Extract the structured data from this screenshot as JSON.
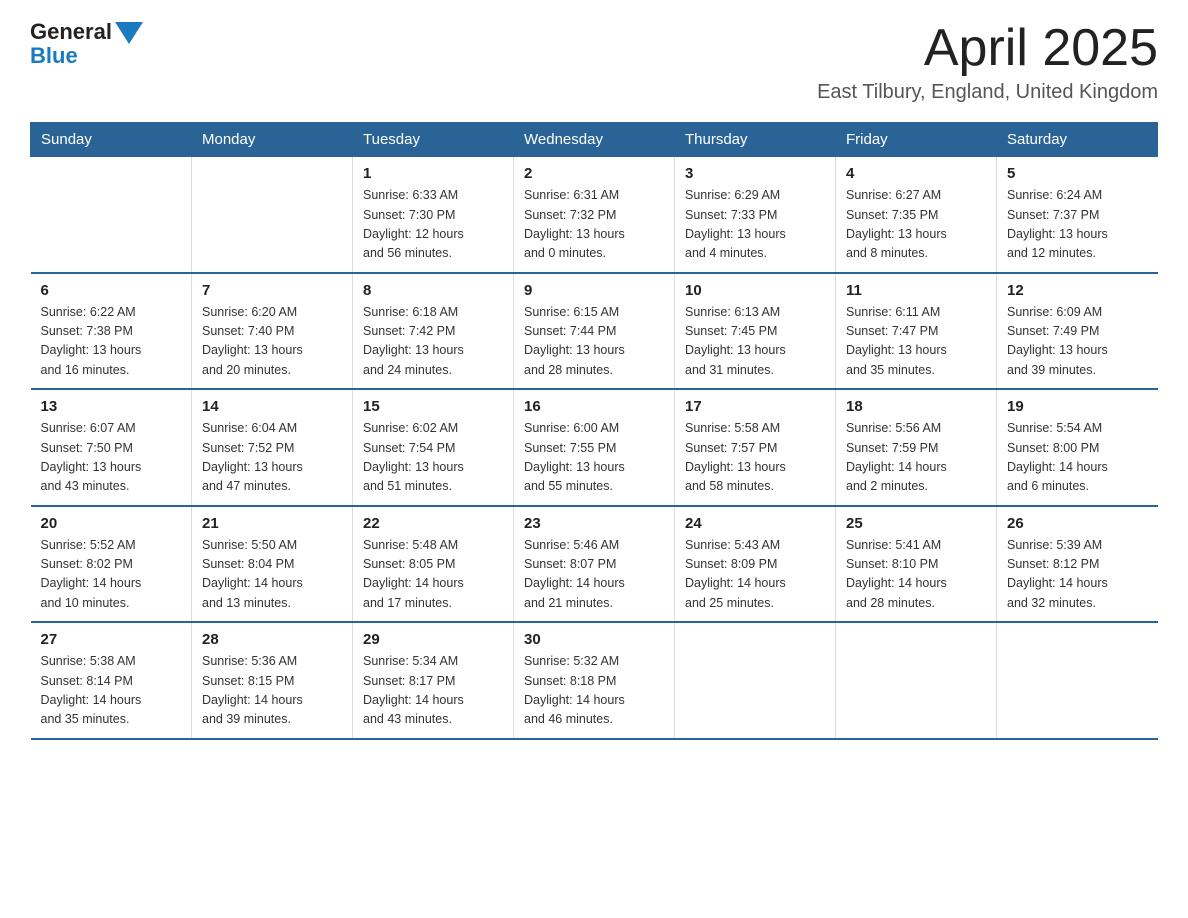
{
  "header": {
    "logo_line1": "General",
    "logo_line2": "Blue",
    "month_title": "April 2025",
    "location": "East Tilbury, England, United Kingdom"
  },
  "days_of_week": [
    "Sunday",
    "Monday",
    "Tuesday",
    "Wednesday",
    "Thursday",
    "Friday",
    "Saturday"
  ],
  "weeks": [
    [
      {
        "day": "",
        "info": ""
      },
      {
        "day": "",
        "info": ""
      },
      {
        "day": "1",
        "info": "Sunrise: 6:33 AM\nSunset: 7:30 PM\nDaylight: 12 hours\nand 56 minutes."
      },
      {
        "day": "2",
        "info": "Sunrise: 6:31 AM\nSunset: 7:32 PM\nDaylight: 13 hours\nand 0 minutes."
      },
      {
        "day": "3",
        "info": "Sunrise: 6:29 AM\nSunset: 7:33 PM\nDaylight: 13 hours\nand 4 minutes."
      },
      {
        "day": "4",
        "info": "Sunrise: 6:27 AM\nSunset: 7:35 PM\nDaylight: 13 hours\nand 8 minutes."
      },
      {
        "day": "5",
        "info": "Sunrise: 6:24 AM\nSunset: 7:37 PM\nDaylight: 13 hours\nand 12 minutes."
      }
    ],
    [
      {
        "day": "6",
        "info": "Sunrise: 6:22 AM\nSunset: 7:38 PM\nDaylight: 13 hours\nand 16 minutes."
      },
      {
        "day": "7",
        "info": "Sunrise: 6:20 AM\nSunset: 7:40 PM\nDaylight: 13 hours\nand 20 minutes."
      },
      {
        "day": "8",
        "info": "Sunrise: 6:18 AM\nSunset: 7:42 PM\nDaylight: 13 hours\nand 24 minutes."
      },
      {
        "day": "9",
        "info": "Sunrise: 6:15 AM\nSunset: 7:44 PM\nDaylight: 13 hours\nand 28 minutes."
      },
      {
        "day": "10",
        "info": "Sunrise: 6:13 AM\nSunset: 7:45 PM\nDaylight: 13 hours\nand 31 minutes."
      },
      {
        "day": "11",
        "info": "Sunrise: 6:11 AM\nSunset: 7:47 PM\nDaylight: 13 hours\nand 35 minutes."
      },
      {
        "day": "12",
        "info": "Sunrise: 6:09 AM\nSunset: 7:49 PM\nDaylight: 13 hours\nand 39 minutes."
      }
    ],
    [
      {
        "day": "13",
        "info": "Sunrise: 6:07 AM\nSunset: 7:50 PM\nDaylight: 13 hours\nand 43 minutes."
      },
      {
        "day": "14",
        "info": "Sunrise: 6:04 AM\nSunset: 7:52 PM\nDaylight: 13 hours\nand 47 minutes."
      },
      {
        "day": "15",
        "info": "Sunrise: 6:02 AM\nSunset: 7:54 PM\nDaylight: 13 hours\nand 51 minutes."
      },
      {
        "day": "16",
        "info": "Sunrise: 6:00 AM\nSunset: 7:55 PM\nDaylight: 13 hours\nand 55 minutes."
      },
      {
        "day": "17",
        "info": "Sunrise: 5:58 AM\nSunset: 7:57 PM\nDaylight: 13 hours\nand 58 minutes."
      },
      {
        "day": "18",
        "info": "Sunrise: 5:56 AM\nSunset: 7:59 PM\nDaylight: 14 hours\nand 2 minutes."
      },
      {
        "day": "19",
        "info": "Sunrise: 5:54 AM\nSunset: 8:00 PM\nDaylight: 14 hours\nand 6 minutes."
      }
    ],
    [
      {
        "day": "20",
        "info": "Sunrise: 5:52 AM\nSunset: 8:02 PM\nDaylight: 14 hours\nand 10 minutes."
      },
      {
        "day": "21",
        "info": "Sunrise: 5:50 AM\nSunset: 8:04 PM\nDaylight: 14 hours\nand 13 minutes."
      },
      {
        "day": "22",
        "info": "Sunrise: 5:48 AM\nSunset: 8:05 PM\nDaylight: 14 hours\nand 17 minutes."
      },
      {
        "day": "23",
        "info": "Sunrise: 5:46 AM\nSunset: 8:07 PM\nDaylight: 14 hours\nand 21 minutes."
      },
      {
        "day": "24",
        "info": "Sunrise: 5:43 AM\nSunset: 8:09 PM\nDaylight: 14 hours\nand 25 minutes."
      },
      {
        "day": "25",
        "info": "Sunrise: 5:41 AM\nSunset: 8:10 PM\nDaylight: 14 hours\nand 28 minutes."
      },
      {
        "day": "26",
        "info": "Sunrise: 5:39 AM\nSunset: 8:12 PM\nDaylight: 14 hours\nand 32 minutes."
      }
    ],
    [
      {
        "day": "27",
        "info": "Sunrise: 5:38 AM\nSunset: 8:14 PM\nDaylight: 14 hours\nand 35 minutes."
      },
      {
        "day": "28",
        "info": "Sunrise: 5:36 AM\nSunset: 8:15 PM\nDaylight: 14 hours\nand 39 minutes."
      },
      {
        "day": "29",
        "info": "Sunrise: 5:34 AM\nSunset: 8:17 PM\nDaylight: 14 hours\nand 43 minutes."
      },
      {
        "day": "30",
        "info": "Sunrise: 5:32 AM\nSunset: 8:18 PM\nDaylight: 14 hours\nand 46 minutes."
      },
      {
        "day": "",
        "info": ""
      },
      {
        "day": "",
        "info": ""
      },
      {
        "day": "",
        "info": ""
      }
    ]
  ]
}
